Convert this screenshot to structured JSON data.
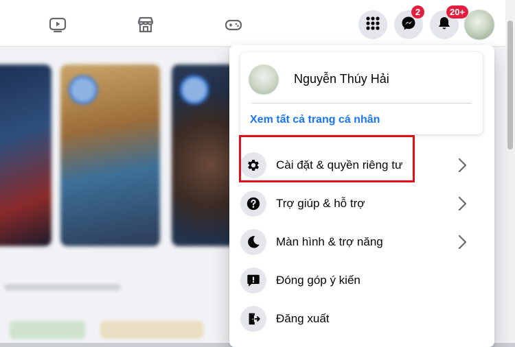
{
  "topbar": {
    "nav_icons": [
      "watch-icon",
      "marketplace-icon",
      "gaming-icon"
    ],
    "menu_icon": "grid-menu-icon",
    "messenger_badge": "2",
    "notifications_badge": "20+"
  },
  "menu": {
    "profile_name": "Nguyễn Thúy Hải",
    "profile_link": "Xem tất cả trang cá nhân",
    "items": [
      {
        "label": "Cài đặt & quyền riêng tư",
        "icon": "gear-icon",
        "has_chevron": true
      },
      {
        "label": "Trợ giúp & hỗ trợ",
        "icon": "help-icon",
        "has_chevron": true
      },
      {
        "label": "Màn hình & trợ năng",
        "icon": "moon-icon",
        "has_chevron": true
      },
      {
        "label": "Đóng góp ý kiến",
        "icon": "feedback-icon",
        "has_chevron": false
      },
      {
        "label": "Đăng xuất",
        "icon": "logout-icon",
        "has_chevron": false
      }
    ]
  },
  "colors": {
    "accent": "#1876f2",
    "badge": "#e41e3f",
    "highlight": "#e0101a"
  }
}
